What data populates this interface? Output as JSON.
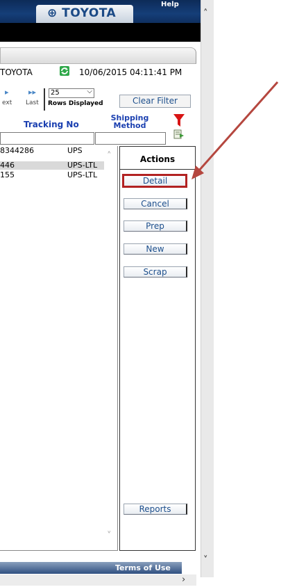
{
  "header": {
    "brand": "TOYOTA",
    "help_label": "Help"
  },
  "toolbar": {
    "company": "TOYOTA",
    "timestamp": "10/06/2015 04:11:41 PM"
  },
  "pager": {
    "next_label": "ext",
    "last_label": "Last",
    "rows_value": "25",
    "rows_label": "Rows Displayed",
    "clear_filter": "Clear Filter"
  },
  "columns": {
    "tracking": "Tracking No",
    "shipping_line1": "Shipping",
    "shipping_line2": "Method"
  },
  "rows": [
    {
      "tracking": "8344286",
      "shipping": "UPS"
    },
    {
      "tracking": "446",
      "shipping": "UPS-LTL"
    },
    {
      "tracking": "155",
      "shipping": "UPS-LTL"
    }
  ],
  "actions": {
    "title": "Actions",
    "detail": "Detail",
    "cancel": "Cancel",
    "prep": "Prep",
    "new": "New",
    "scrap": "Scrap",
    "reports": "Reports"
  },
  "footer": {
    "terms": "Terms of Use"
  },
  "colors": {
    "nav": "#0d2b58",
    "link": "#1a3fb0",
    "highlight": "#b22222",
    "annotation_arrow": "#b5473f"
  }
}
